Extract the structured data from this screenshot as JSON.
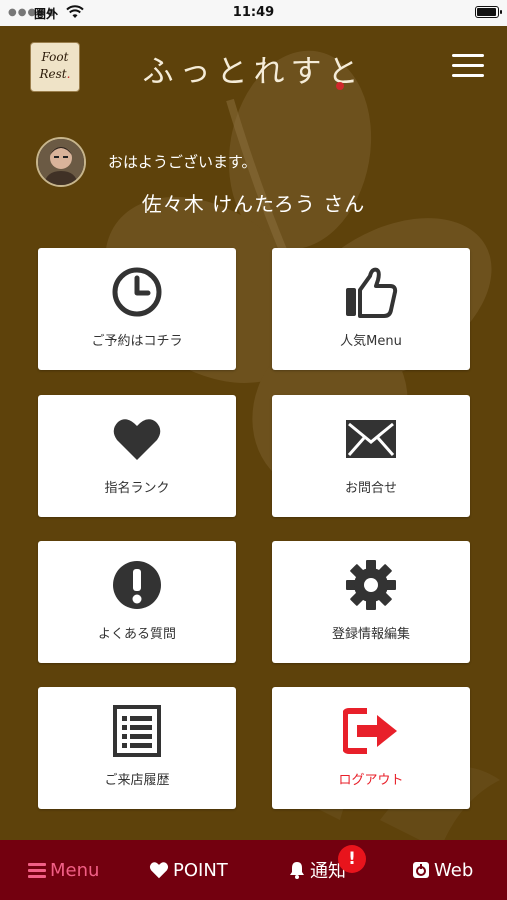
{
  "status_bar": {
    "signal": "●●●●●",
    "carrier": "圏外",
    "time": "11:49"
  },
  "header": {
    "logo_line1": "Foot",
    "logo_line2": "Rest",
    "brand": "ふっとれすと"
  },
  "greeting": {
    "message": "おはようございます。",
    "user_name": "佐々木 けんたろう さん"
  },
  "tiles": [
    {
      "label": "ご予約はコチラ",
      "icon": "clock-icon"
    },
    {
      "label": "人気Menu",
      "icon": "thumbs-up-icon"
    },
    {
      "label": "指名ランク",
      "icon": "heart-icon"
    },
    {
      "label": "お問合せ",
      "icon": "envelope-icon"
    },
    {
      "label": "よくある質問",
      "icon": "exclamation-icon"
    },
    {
      "label": "登録情報編集",
      "icon": "gear-icon"
    },
    {
      "label": "ご来店履歴",
      "icon": "list-icon"
    },
    {
      "label": "ログアウト",
      "icon": "logout-icon"
    }
  ],
  "tab_bar": {
    "menu": "Menu",
    "point": "POINT",
    "notice": "通知",
    "notice_badge": "!",
    "web": "Web"
  },
  "colors": {
    "background": "#5e420b",
    "tab_bar": "#73000f",
    "active_tab": "#f25f86",
    "logout": "#e8202a",
    "badge": "#e8141c"
  }
}
